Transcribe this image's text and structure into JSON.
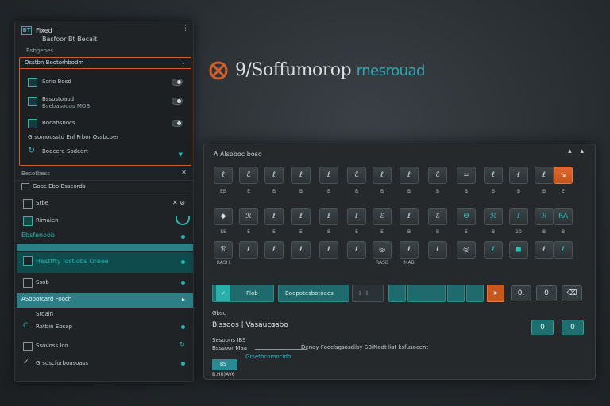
{
  "colors": {
    "accent_teal": "#2bb3ad",
    "accent_orange": "#c9612a",
    "panel": "#1f2326"
  },
  "left_panel": {
    "app_icon": "app-logo-icon",
    "logo_text": "BT",
    "title": "Fixed",
    "close": "⋮",
    "subtitle": "Basfoor Bt Becait",
    "section": "Bsbgenes",
    "dropdown_label": "Osstbn Bootorhbodm",
    "dropdown_rows": [
      {
        "label": "Scrio Bosd",
        "icon": "folder-icon"
      },
      {
        "label": "Bssostoaod",
        "label2": "Bsebasooas MOB",
        "icon": "gear-icon"
      },
      {
        "label": "Bocabsnocs",
        "icon": "file-icon"
      }
    ],
    "group_title": "Grsomoosstd Enl Frbor Ossbcoer",
    "group_item": "Bodcere Sodcert",
    "section2": "Becotbess",
    "list_header": "Gooc Ebo Bsscords",
    "list_items": [
      {
        "label": "Srbe"
      },
      {
        "label": "Rimaien"
      },
      {
        "label": "Ebsfenoob"
      },
      {
        "label": "Hestffty lostiobs Oreee"
      },
      {
        "label": "Ssob"
      },
      {
        "label": "ASobotcard Fooch"
      },
      {
        "label": "Sroain"
      },
      {
        "label": "Ratbin Ebsap"
      },
      {
        "label": "Ssovoss Ico"
      },
      {
        "label": "Grsdscforboasoass"
      }
    ]
  },
  "brand": {
    "main": "9/Soffumorop",
    "accent": "rnesrouad"
  },
  "keyboard": {
    "title": "A Alsoboc boso",
    "controls": "▴ ▴",
    "row1": [
      "ℓ",
      "ℰ",
      "ℓ",
      "ℓ",
      "ℓ",
      "ℰ",
      "ℓ",
      "ℓ",
      "ℰ",
      "=",
      "ℓ",
      "ℓ",
      "ℓ",
      "↘"
    ],
    "row1_labels": [
      "EB",
      "E",
      "B",
      "B",
      "B",
      "B",
      "B",
      "B",
      "B",
      "B",
      "B",
      "B",
      "B",
      "E"
    ],
    "row2": [
      "◆",
      "ℛ",
      "ℓ",
      "ℓ",
      "ℓ",
      "ℓ",
      "ℰ",
      "ℓ",
      "ℰ",
      "Θ",
      "ℛ",
      "ℓ",
      "ℛ",
      "RA"
    ],
    "row2_labels": [
      "ES",
      "E",
      "E",
      "E",
      "B",
      "E",
      "E",
      "B",
      "B",
      "E",
      "B",
      "10",
      "B",
      "B"
    ],
    "row3": [
      "ℛ",
      "ℓ",
      "ℓ",
      "ℓ",
      "ℓ",
      "ℓ",
      "◎",
      "ℓ",
      "ℓ",
      "◎",
      "ℓ",
      "◼",
      "ℓ",
      "ℓ"
    ],
    "row3_labels": [
      "RASH",
      "",
      "",
      "",
      "",
      "",
      "RASB",
      "MAB",
      "",
      "",
      "",
      "",
      "",
      ""
    ],
    "bar_label": "Flob",
    "bar2_label": "Boopotesbotoeos",
    "small_btns": [
      "0.",
      "0",
      "⌫"
    ],
    "footer_label": "Gbsc",
    "footer_big": "Blssoos   |   Vasaucosbo",
    "footer_value": "0",
    "status1": "Sesoons IBS",
    "status2": "Bsssoor Maa",
    "status_long": "Denay Fooclsgsosdiby SBiNodt list ksfusocent",
    "status_bar": "Grsetbcomocidb",
    "footer_btn": "BS",
    "footer_small": "B.H(I)AV6",
    "ok_btns": [
      "0",
      "0"
    ]
  }
}
